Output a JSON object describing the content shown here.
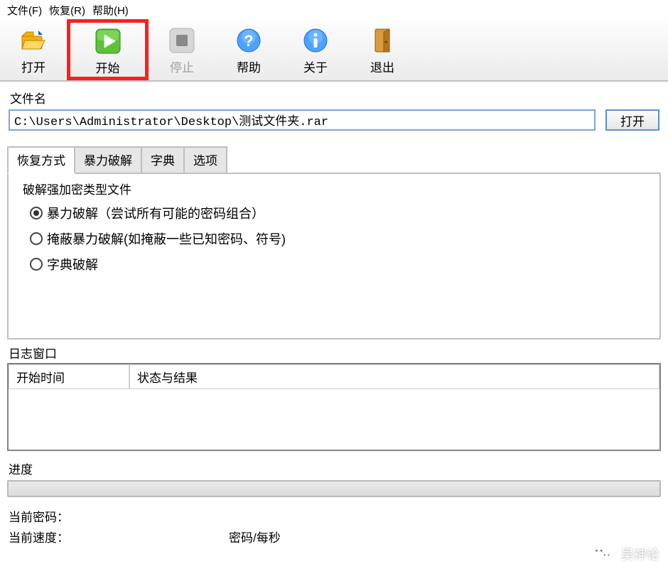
{
  "menubar": {
    "file": "文件(F)",
    "recover": "恢复(R)",
    "help": "帮助(H)"
  },
  "toolbar": {
    "open": "打开",
    "start": "开始",
    "stop": "停止",
    "help": "帮助",
    "about": "关于",
    "exit": "退出"
  },
  "filename": {
    "label": "文件名",
    "value": "C:\\Users\\Administrator\\Desktop\\测试文件夹.rar",
    "open_btn": "打开"
  },
  "tabs": {
    "method": "恢复方式",
    "brute": "暴力破解",
    "dict": "字典",
    "options": "选项"
  },
  "method_group": {
    "title": "破解强加密类型文件",
    "opt_brute": "暴力破解（尝试所有可能的密码组合）",
    "opt_mask": "掩蔽暴力破解(如掩蔽一些已知密码、符号)",
    "opt_dict": "字典破解"
  },
  "log": {
    "title": "日志窗口",
    "col_time": "开始时间",
    "col_result": "状态与结果"
  },
  "progress": {
    "title": "进度",
    "current_pw_label": "当前密码：",
    "current_speed_label": "当前速度：",
    "rate_unit": "密码/每秒"
  },
  "watermark": {
    "text": "吴神论"
  }
}
